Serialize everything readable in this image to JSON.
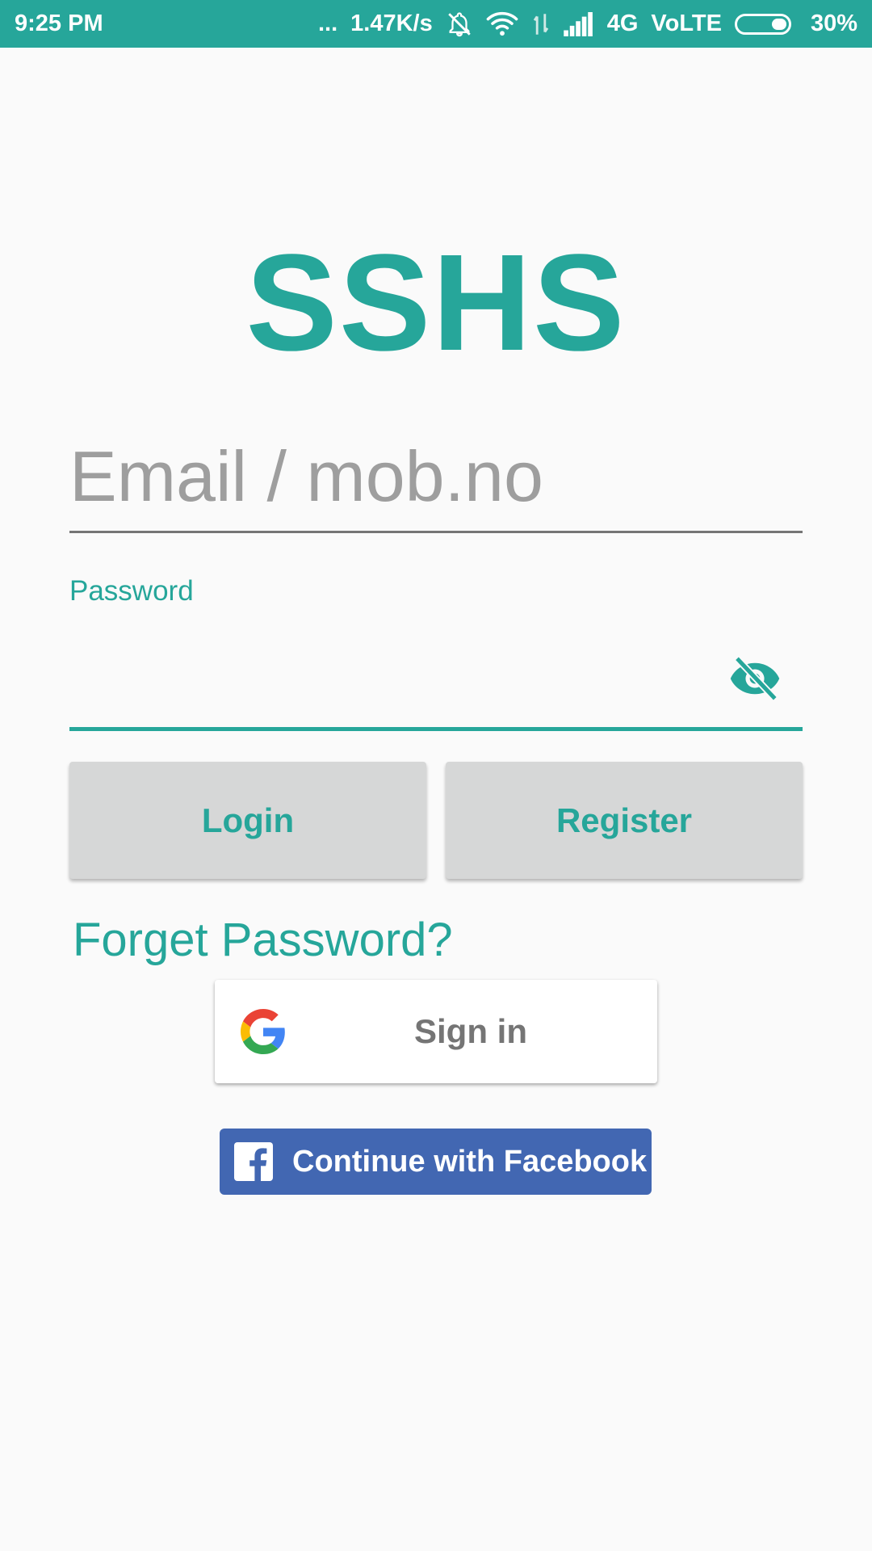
{
  "status_bar": {
    "time": "9:25 PM",
    "more": "...",
    "speed": "1.47K/s",
    "network": "4G",
    "volte": "VoLTE",
    "battery": "30%"
  },
  "app": {
    "title": "SSHS"
  },
  "form": {
    "email_placeholder": "Email / mob.no",
    "email_value": "",
    "password_label": "Password",
    "password_value": ""
  },
  "buttons": {
    "login": "Login",
    "register": "Register",
    "forget_password": "Forget Password?",
    "google_sign_in": "Sign in",
    "facebook": "Continue with Facebook"
  },
  "colors": {
    "accent": "#26a69a",
    "button_bg": "#d6d7d7",
    "facebook": "#4267b2"
  },
  "icons": {
    "password_toggle": "eye-off-icon",
    "google": "google-g-icon",
    "facebook": "facebook-f-icon"
  }
}
